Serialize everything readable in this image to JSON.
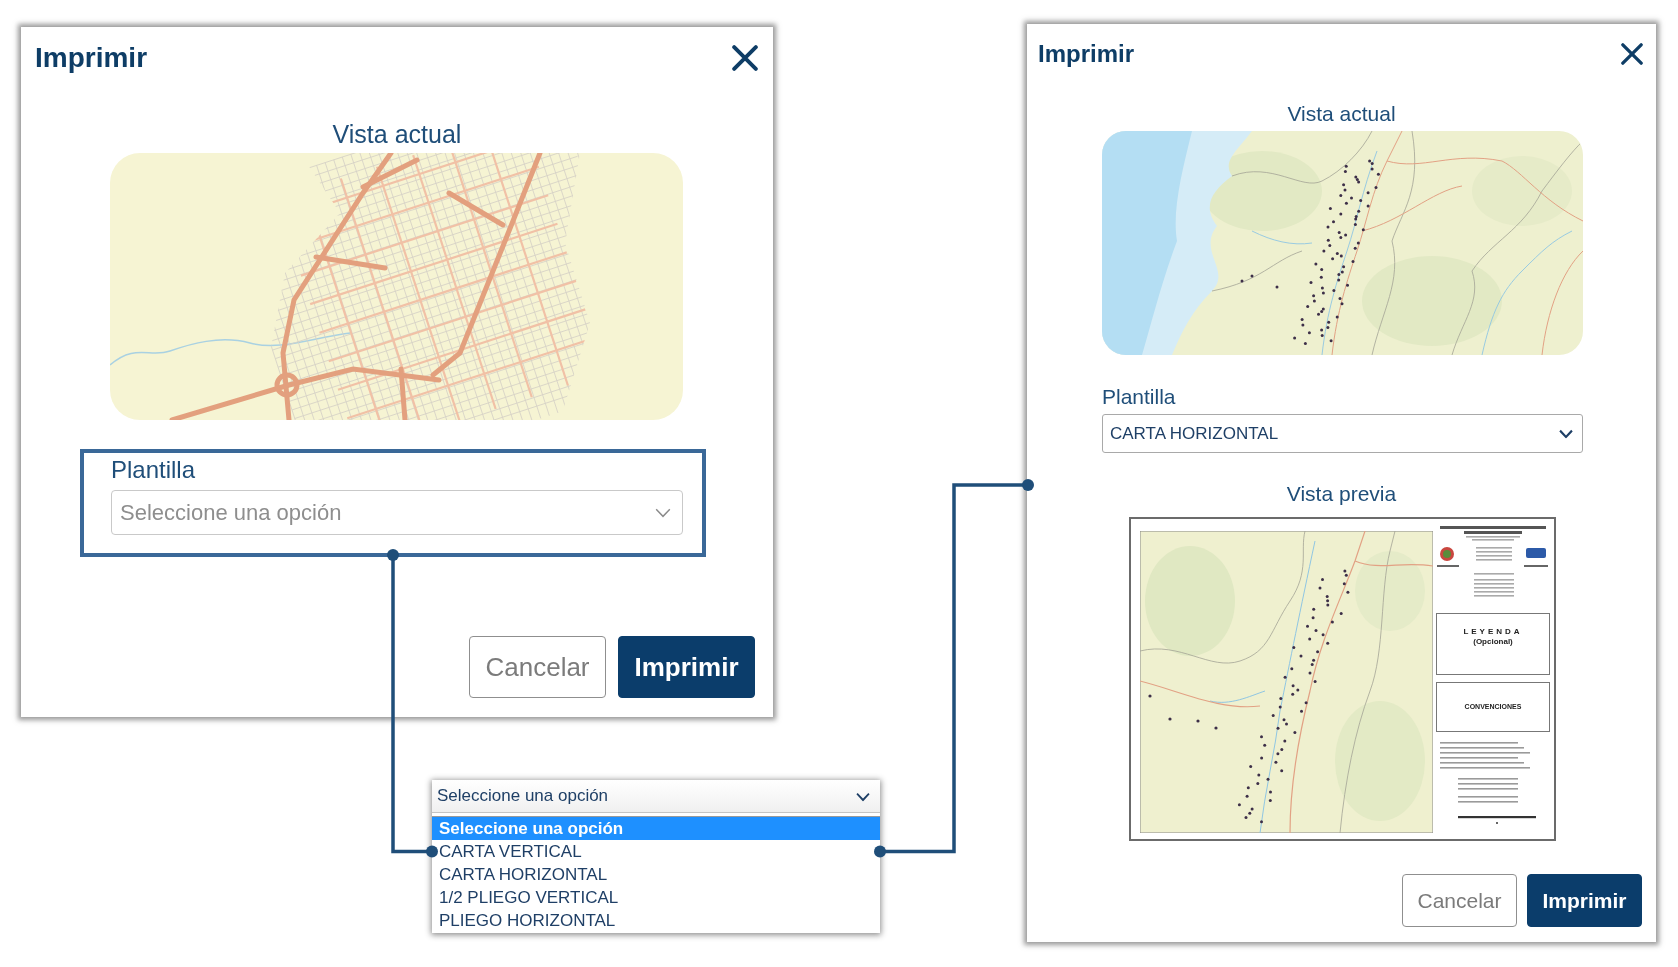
{
  "steps": [
    {
      "kind": "dialog",
      "title": "Imprimir",
      "current_view": {
        "heading": "Vista actual",
        "map": {
          "kind": "city"
        }
      },
      "template": {
        "label": "Plantilla",
        "placeholder": "Seleccione una opción",
        "highlighted": true
      },
      "buttons": [
        {
          "label": "Cancelar",
          "kind": "secondary"
        },
        {
          "label": "Imprimir",
          "kind": "primary"
        }
      ]
    },
    {
      "kind": "dropdown",
      "value": "Seleccione una opción",
      "options": [
        {
          "label": "Seleccione una opción",
          "selected": true
        },
        {
          "label": "CARTA VERTICAL",
          "selected": false
        },
        {
          "label": "CARTA HORIZONTAL",
          "selected": false
        },
        {
          "label": "1/2 PLIEGO VERTICAL",
          "selected": false
        },
        {
          "label": "PLIEGO HORIZONTAL",
          "selected": false
        }
      ]
    },
    {
      "kind": "dialog",
      "title": "Imprimir",
      "current_view": {
        "heading": "Vista actual",
        "map": {
          "kind": "region"
        }
      },
      "template": {
        "label": "Plantilla",
        "value": "CARTA HORIZONTAL"
      },
      "preview": {
        "heading": "Vista previa",
        "legend_title": "LEYENDA",
        "legend_note": "(Opcional)",
        "conventions_title": "CONVENCIONES"
      },
      "buttons": [
        {
          "label": "Cancelar",
          "kind": "secondary"
        },
        {
          "label": "Imprimir",
          "kind": "primary"
        }
      ]
    }
  ]
}
